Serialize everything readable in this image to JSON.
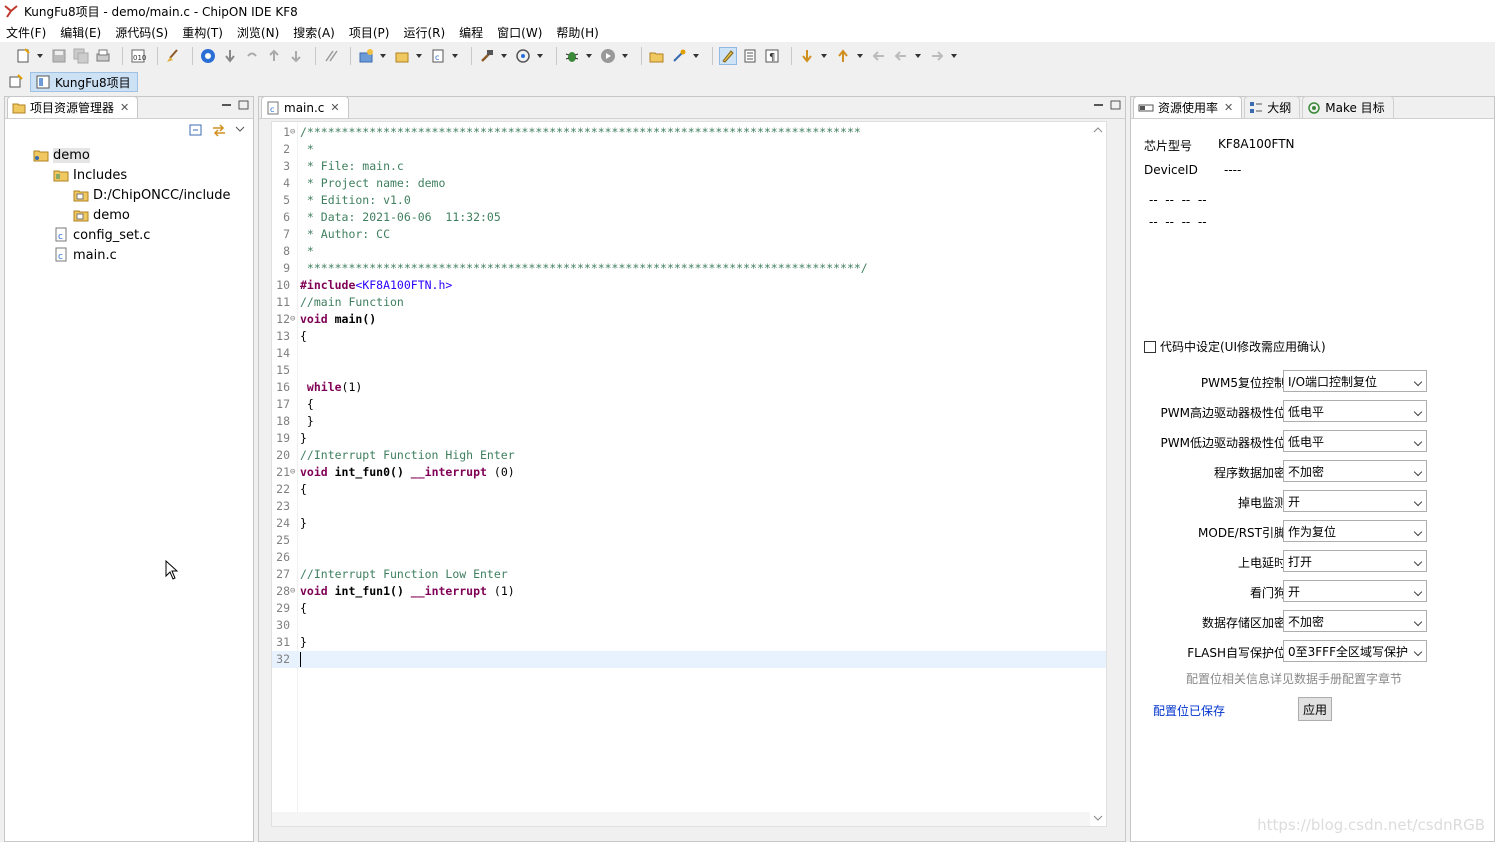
{
  "window": {
    "title": "KungFu8项目 - demo/main.c - ChipON IDE KF8"
  },
  "menu": [
    "文件(F)",
    "编辑(E)",
    "源代码(S)",
    "重构(T)",
    "浏览(N)",
    "搜索(A)",
    "项目(P)",
    "运行(R)",
    "编程",
    "窗口(W)",
    "帮助(H)"
  ],
  "perspective": {
    "label": "KungFu8项目"
  },
  "project_explorer": {
    "tab_label": "项目资源管理器",
    "tree": [
      {
        "label": "demo",
        "level": 0,
        "icon": "project-folder-icon"
      },
      {
        "label": "Includes",
        "level": 1,
        "icon": "includes-folder-icon"
      },
      {
        "label": "D:/ChipONCC/include",
        "level": 2,
        "icon": "include-path-icon"
      },
      {
        "label": "demo",
        "level": 2,
        "icon": "include-path-icon"
      },
      {
        "label": "config_set.c",
        "level": 1,
        "icon": "c-file-icon"
      },
      {
        "label": "main.c",
        "level": 1,
        "icon": "c-file-icon"
      }
    ]
  },
  "editor": {
    "tab_label": "main.c",
    "lines": [
      {
        "n": "1",
        "fold": true,
        "text": "/********************************************************************************",
        "cls": "c-comment"
      },
      {
        "n": "2",
        "text": " *",
        "cls": "c-comment"
      },
      {
        "n": "3",
        "text": " * File: main.c",
        "cls": "c-comment"
      },
      {
        "n": "4",
        "text": " * Project name: demo",
        "cls": "c-comment"
      },
      {
        "n": "5",
        "text": " * Edition: v1.0",
        "cls": "c-comment"
      },
      {
        "n": "6",
        "text": " * Data: 2021-06-06  11:32:05",
        "cls": "c-comment"
      },
      {
        "n": "7",
        "text": " * Author: CC",
        "cls": "c-comment"
      },
      {
        "n": "8",
        "text": " *",
        "cls": "c-comment"
      },
      {
        "n": "9",
        "text": " ********************************************************************************/",
        "cls": "c-comment"
      },
      {
        "n": "10",
        "text": "#include<KF8A100FTN.h>",
        "cls": "include"
      },
      {
        "n": "11",
        "text": "//main Function",
        "cls": "c-comment"
      },
      {
        "n": "12",
        "fold": true,
        "text": "void main()",
        "cls": "func",
        "kw": "void",
        "rest": " main()"
      },
      {
        "n": "13",
        "text": "{",
        "cls": ""
      },
      {
        "n": "14",
        "text": "",
        "cls": ""
      },
      {
        "n": "15",
        "text": "",
        "cls": ""
      },
      {
        "n": "16",
        "text": " while(1)",
        "cls": "kwline",
        "kw": " while",
        "rest": "(1)"
      },
      {
        "n": "17",
        "text": " {",
        "cls": ""
      },
      {
        "n": "18",
        "text": " }",
        "cls": ""
      },
      {
        "n": "19",
        "text": "}",
        "cls": ""
      },
      {
        "n": "20",
        "text": "//Interrupt Function High Enter",
        "cls": "c-comment"
      },
      {
        "n": "21",
        "fold": true,
        "text": "void int_fun0() __interrupt (0)",
        "cls": "func",
        "kw": "void",
        "rest": " int_fun0() ",
        "kw2": "__interrupt",
        "rest2": " (0)"
      },
      {
        "n": "22",
        "text": "{",
        "cls": ""
      },
      {
        "n": "23",
        "text": "",
        "cls": ""
      },
      {
        "n": "24",
        "text": "}",
        "cls": ""
      },
      {
        "n": "25",
        "text": "",
        "cls": ""
      },
      {
        "n": "26",
        "text": "",
        "cls": ""
      },
      {
        "n": "27",
        "text": "//Interrupt Function Low Enter",
        "cls": "c-comment"
      },
      {
        "n": "28",
        "fold": true,
        "text": "void int_fun1() __interrupt (1)",
        "cls": "func",
        "kw": "void",
        "rest": " int_fun1() ",
        "kw2": "__interrupt",
        "rest2": " (1)"
      },
      {
        "n": "29",
        "text": "{",
        "cls": ""
      },
      {
        "n": "30",
        "text": "",
        "cls": ""
      },
      {
        "n": "31",
        "text": "}",
        "cls": ""
      },
      {
        "n": "32",
        "text": "",
        "cls": "",
        "current": true
      }
    ]
  },
  "right_panel": {
    "tabs": [
      "资源使用率",
      "大纲",
      "Make 目标"
    ],
    "chip_label": "芯片型号",
    "chip_value": "KF8A100FTN",
    "device_label": "DeviceID",
    "device_value": "----",
    "dash_row1": "--  --  --  --",
    "dash_row2": "--  --  --  --",
    "checkbox_label": "代码中设定(UI修改需应用确认)",
    "config": [
      {
        "label": "PWM5复位控制",
        "value": "I/O端口控制复位"
      },
      {
        "label": "PWM高边驱动器极性位",
        "value": "低电平"
      },
      {
        "label": "PWM低边驱动器极性位",
        "value": "低电平"
      },
      {
        "label": "程序数据加密",
        "value": "不加密"
      },
      {
        "label": "掉电监测",
        "value": "开"
      },
      {
        "label": "MODE/RST引脚",
        "value": "作为复位"
      },
      {
        "label": "上电延时",
        "value": "打开"
      },
      {
        "label": "看门狗",
        "value": "开"
      },
      {
        "label": "数据存储区加密",
        "value": "不加密"
      },
      {
        "label": "FLASH自写保护位",
        "value": "0至3FFF全区域写保护"
      }
    ],
    "hint": "配置位相关信息详见数据手册配置字章节",
    "saved_link": "配置位已保存",
    "apply_label": "应用"
  },
  "watermark": "https://blog.csdn.net/csdnRGB"
}
